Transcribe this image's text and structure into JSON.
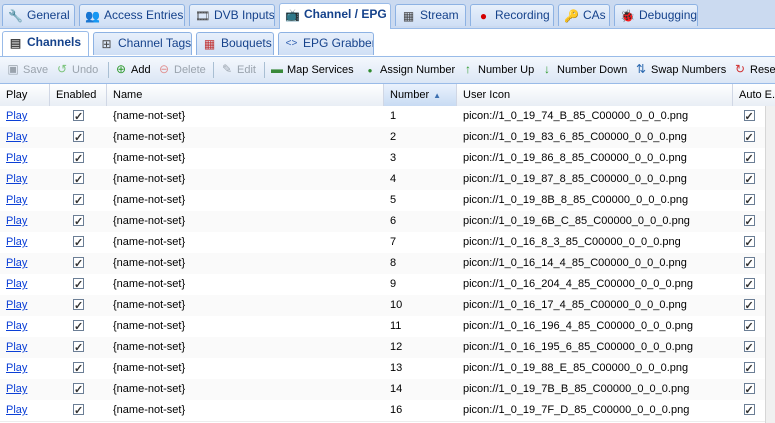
{
  "main_tabs": [
    {
      "label": "General",
      "icon": "wrench-icon",
      "glyph": "🔧"
    },
    {
      "label": "Access Entries",
      "icon": "users-icon",
      "glyph": "👥"
    },
    {
      "label": "DVB Inputs",
      "icon": "film-icon",
      "glyph": "🎞"
    },
    {
      "label": "Channel / EPG",
      "icon": "tv-icon",
      "glyph": "📺"
    },
    {
      "label": "Stream",
      "icon": "stream-icon",
      "glyph": "▦"
    },
    {
      "label": "Recording",
      "icon": "rec-icon",
      "glyph": "●"
    },
    {
      "label": "CAs",
      "icon": "key-icon",
      "glyph": "🔑"
    },
    {
      "label": "Debugging",
      "icon": "bug-icon",
      "glyph": "🐞"
    }
  ],
  "sub_tabs": [
    {
      "label": "Channels",
      "icon": "channels-icon",
      "glyph": "▤"
    },
    {
      "label": "Channel Tags",
      "icon": "tags-icon",
      "glyph": "⊞"
    },
    {
      "label": "Bouquets",
      "icon": "bouquet-icon",
      "glyph": "▦"
    },
    {
      "label": "EPG Grabber",
      "icon": "code-icon",
      "glyph": "<>"
    }
  ],
  "toolbar": {
    "save": "Save",
    "undo": "Undo",
    "add": "Add",
    "delete": "Delete",
    "edit": "Edit",
    "map_services": "Map Services",
    "assign_number": "Assign Number",
    "number_up": "Number Up",
    "number_down": "Number Down",
    "swap_numbers": "Swap Numbers",
    "reset": "Rese"
  },
  "columns": {
    "play": "Play",
    "enabled": "Enabled",
    "name": "Name",
    "number": "Number",
    "user_icon": "User Icon",
    "auto": "Auto E..."
  },
  "rows": [
    {
      "play": "Play",
      "name": "{name-not-set}",
      "number": "1",
      "icon": "picon://1_0_19_74_B_85_C00000_0_0_0.png"
    },
    {
      "play": "Play",
      "name": "{name-not-set}",
      "number": "2",
      "icon": "picon://1_0_19_83_6_85_C00000_0_0_0.png"
    },
    {
      "play": "Play",
      "name": "{name-not-set}",
      "number": "3",
      "icon": "picon://1_0_19_86_8_85_C00000_0_0_0.png"
    },
    {
      "play": "Play",
      "name": "{name-not-set}",
      "number": "4",
      "icon": "picon://1_0_19_87_8_85_C00000_0_0_0.png"
    },
    {
      "play": "Play",
      "name": "{name-not-set}",
      "number": "5",
      "icon": "picon://1_0_19_8B_8_85_C00000_0_0_0.png"
    },
    {
      "play": "Play",
      "name": "{name-not-set}",
      "number": "6",
      "icon": "picon://1_0_19_6B_C_85_C00000_0_0_0.png"
    },
    {
      "play": "Play",
      "name": "{name-not-set}",
      "number": "7",
      "icon": "picon://1_0_16_8_3_85_C00000_0_0_0.png"
    },
    {
      "play": "Play",
      "name": "{name-not-set}",
      "number": "8",
      "icon": "picon://1_0_16_14_4_85_C00000_0_0_0.png"
    },
    {
      "play": "Play",
      "name": "{name-not-set}",
      "number": "9",
      "icon": "picon://1_0_16_204_4_85_C00000_0_0_0.png"
    },
    {
      "play": "Play",
      "name": "{name-not-set}",
      "number": "10",
      "icon": "picon://1_0_16_17_4_85_C00000_0_0_0.png"
    },
    {
      "play": "Play",
      "name": "{name-not-set}",
      "number": "11",
      "icon": "picon://1_0_16_196_4_85_C00000_0_0_0.png"
    },
    {
      "play": "Play",
      "name": "{name-not-set}",
      "number": "12",
      "icon": "picon://1_0_16_195_6_85_C00000_0_0_0.png"
    },
    {
      "play": "Play",
      "name": "{name-not-set}",
      "number": "13",
      "icon": "picon://1_0_19_88_E_85_C00000_0_0_0.png"
    },
    {
      "play": "Play",
      "name": "{name-not-set}",
      "number": "14",
      "icon": "picon://1_0_19_7B_B_85_C00000_0_0_0.png"
    },
    {
      "play": "Play",
      "name": "{name-not-set}",
      "number": "16",
      "icon": "picon://1_0_19_7F_D_85_C00000_0_0_0.png"
    }
  ]
}
